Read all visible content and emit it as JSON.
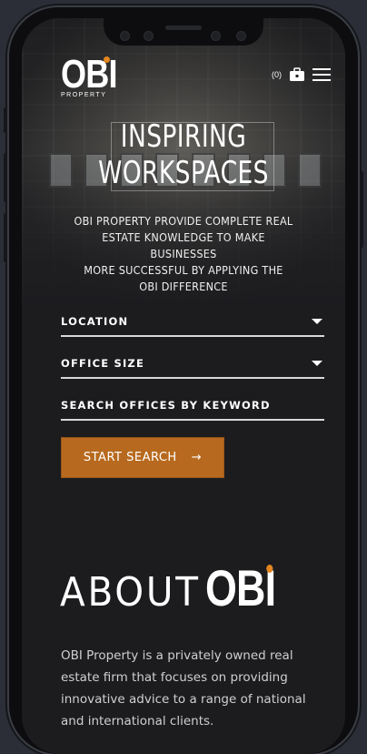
{
  "brand": {
    "logo_text": "OBI",
    "logo_sub": "PROPERTY",
    "accent_color": "#e3861e",
    "button_color": "#b76a1f"
  },
  "header": {
    "cart_count": "(0)",
    "cart_icon": "briefcase-icon",
    "menu_icon": "hamburger-icon"
  },
  "hero": {
    "title_line1": "INSPIRING",
    "title_line2": "WORKSPACES",
    "subtitle_line1": "OBI PROPERTY PROVIDE COMPLETE REAL",
    "subtitle_line2": "ESTATE KNOWLEDGE TO MAKE BUSINESSES",
    "subtitle_line3": "MORE SUCCESSFUL BY APPLYING THE",
    "subtitle_line4": "OBI DIFFERENCE"
  },
  "search": {
    "location_label": "LOCATION",
    "office_size_label": "OFFICE SIZE",
    "keyword_placeholder": "SEARCH OFFICES BY KEYWORD",
    "start_button_label": "START SEARCH",
    "start_button_arrow": "→"
  },
  "about": {
    "heading_word": "ABOUT",
    "heading_logo": "OBI",
    "paragraph": "OBI Property is a privately owned real estate firm that focuses on providing innovative advice to a range of national and international clients."
  }
}
